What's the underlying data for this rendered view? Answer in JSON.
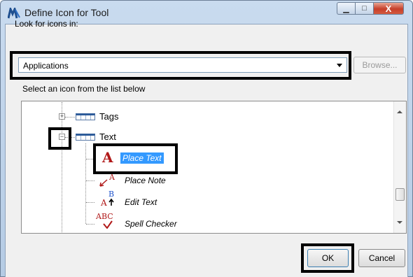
{
  "window": {
    "title": "Define Icon for Tool",
    "min_glyph": "▁",
    "max_glyph": "□",
    "close_glyph": "X"
  },
  "look_for": {
    "label": "Look for icons in:",
    "selected": "Applications",
    "browse_label": "Browse..."
  },
  "instruction": "Select an icon from the list below",
  "tree": {
    "nodes": [
      {
        "label": "Tags",
        "expander": "+"
      },
      {
        "label": "Text",
        "expander": "−"
      }
    ],
    "items": [
      {
        "label": "Place Text",
        "glyph": "A",
        "selected": true
      },
      {
        "label": "Place Note",
        "glyph": "A"
      },
      {
        "label": "Edit Text",
        "glyph_top": "B",
        "glyph_bottom": "A"
      },
      {
        "label": "Spell Checker",
        "glyph": "ABC"
      }
    ]
  },
  "buttons": {
    "ok": "OK",
    "cancel": "Cancel"
  },
  "colors": {
    "selection": "#3399ff",
    "highlight_box": "#000000",
    "icon_red": "#b01818"
  }
}
